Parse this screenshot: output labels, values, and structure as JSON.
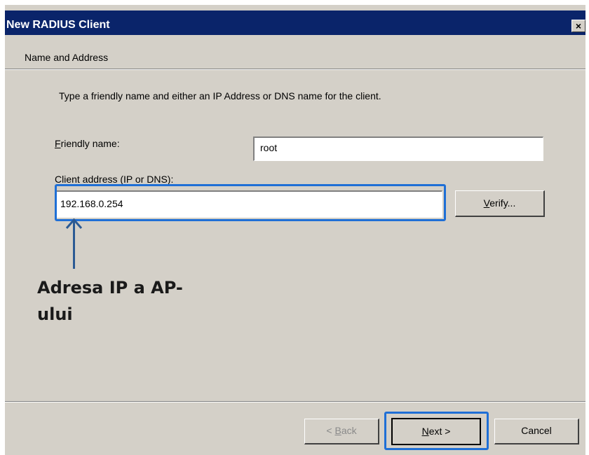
{
  "window": {
    "title": "New RADIUS Client",
    "close_glyph": "×"
  },
  "header": {
    "section_title": "Name and Address"
  },
  "form": {
    "instruction": "Type a friendly name and either an IP Address or DNS name for the client.",
    "friendly_name_label_mnemonic": "F",
    "friendly_name_label_rest": "riendly name:",
    "friendly_name_value": "root",
    "client_address_label": "Client address (IP or DNS):",
    "client_address_value": "192.168.0.254",
    "verify_mnemonic": "V",
    "verify_rest": "erify..."
  },
  "footer": {
    "back_prefix": "< ",
    "back_mnemonic": "B",
    "back_rest": "ack",
    "next_mnemonic": "N",
    "next_rest": "ext >",
    "cancel_label": "Cancel"
  },
  "annotation": {
    "text_line1": "Adresa IP a AP-",
    "text_line2": "ului",
    "color": "#1f6fd6"
  }
}
